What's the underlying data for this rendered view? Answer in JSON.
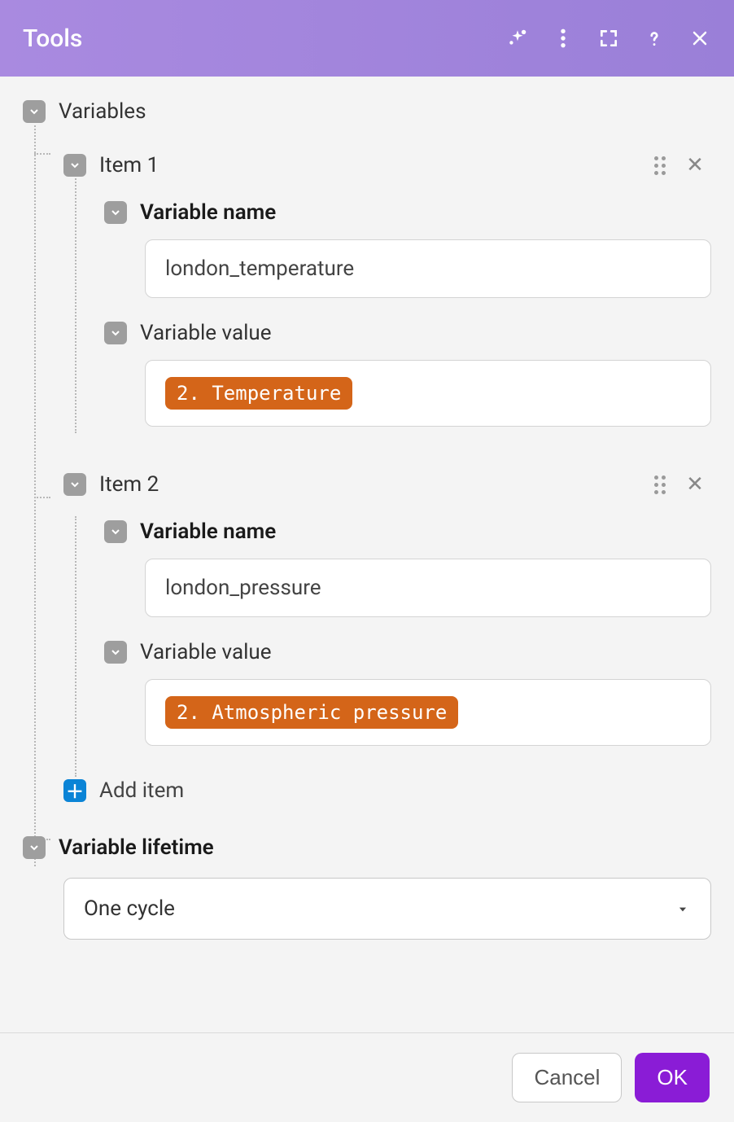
{
  "header": {
    "title": "Tools"
  },
  "variables": {
    "section_label": "Variables",
    "items": [
      {
        "title": "Item 1",
        "name_label": "Variable name",
        "name_value": "london_temperature",
        "value_label": "Variable value",
        "value_chip": "2. Temperature"
      },
      {
        "title": "Item 2",
        "name_label": "Variable name",
        "name_value": "london_pressure",
        "value_label": "Variable value",
        "value_chip": "2. Atmospheric pressure"
      }
    ],
    "add_item_label": "Add item"
  },
  "lifetime": {
    "label": "Variable lifetime",
    "value": "One cycle"
  },
  "footer": {
    "cancel": "Cancel",
    "ok": "OK"
  }
}
